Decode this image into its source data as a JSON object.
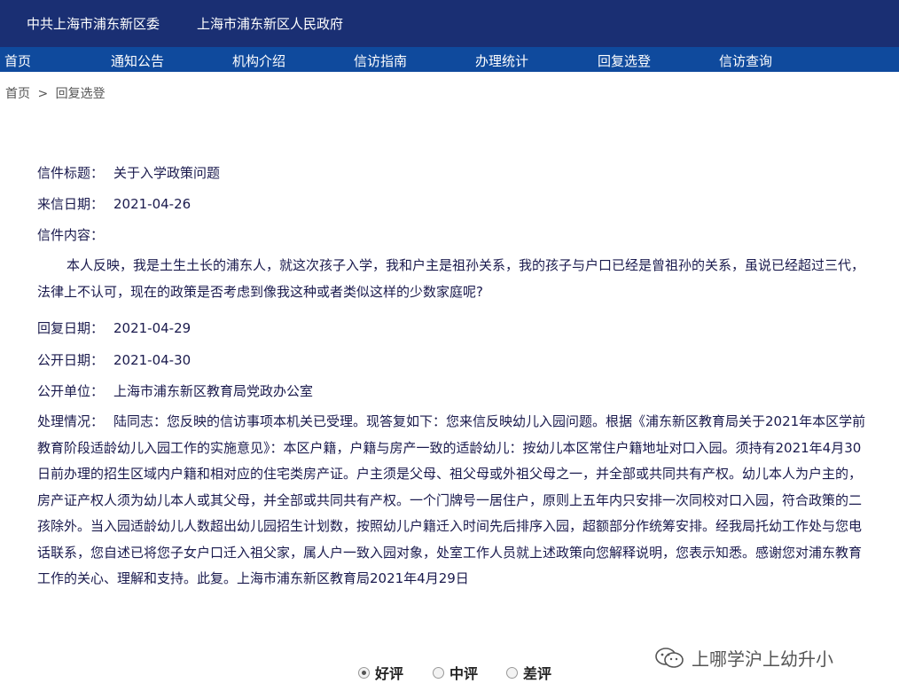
{
  "header": {
    "party_committee": "中共上海市浦东新区委",
    "government": "上海市浦东新区人民政府"
  },
  "nav": {
    "items": [
      "首页",
      "通知公告",
      "机构介绍",
      "信访指南",
      "办理统计",
      "回复选登",
      "信访查询"
    ]
  },
  "breadcrumb": {
    "home": "首页",
    "separator": ">",
    "current": "回复选登"
  },
  "letter": {
    "title_label": "信件标题：",
    "title": "关于入学政策问题",
    "date_label": "来信日期：",
    "date": "2021-04-26",
    "content_label": "信件内容：",
    "content": "本人反映，我是土生土长的浦东人，就这次孩子入学，我和户主是祖孙关系，我的孩子与户口已经是曾祖孙的关系，虽说已经超过三代，法律上不认可，现在的政策是否考虑到像我这种或者类似这样的少数家庭呢?",
    "reply_date_label": "回复日期：",
    "reply_date": "2021-04-29",
    "public_date_label": "公开日期：",
    "public_date": "2021-04-30",
    "unit_label": "公开单位：",
    "unit": "上海市浦东新区教育局党政办公室",
    "handling_label": "处理情况：",
    "handling": "陆同志：您反映的信访事项本机关已受理。现答复如下：您来信反映幼儿入园问题。根据《浦东新区教育局关于2021年本区学前教育阶段适龄幼儿入园工作的实施意见》：本区户籍，户籍与房产一致的适龄幼儿：按幼儿本区常住户籍地址对口入园。须持有2021年4月30日前办理的招生区域内户籍和相对应的住宅类房产证。户主须是父母、祖父母或外祖父母之一，并全部或共同共有产权。幼儿本人为户主的，房产证产权人须为幼儿本人或其父母，并全部或共同共有产权。一个门牌号一居住户，原则上五年内只安排一次同校对口入园，符合政策的二孩除外。当入园适龄幼儿人数超出幼儿园招生计划数，按照幼儿户籍迁入时间先后排序入园，超额部分作统筹安排。经我局托幼工作处与您电话联系，您自述已将您子女户口迁入祖父家，属人户一致入园对象，处室工作人员就上述政策向您解释说明，您表示知悉。感谢您对浦东教育工作的关心、理解和支持。此复。上海市浦东新区教育局2021年4月29日"
  },
  "rating": {
    "good": "好评",
    "medium": "中评",
    "bad": "差评",
    "selected": "good"
  },
  "watermark": {
    "text": "上哪学沪上幼升小",
    "icon": "wechat-icon"
  }
}
